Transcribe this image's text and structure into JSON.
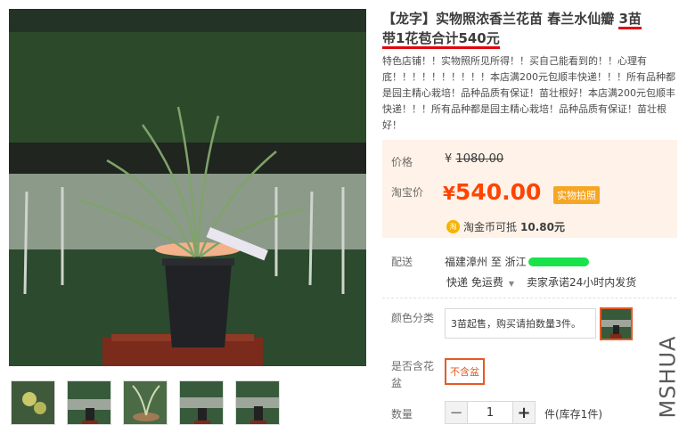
{
  "product": {
    "title_part1": "【龙字】实物照浓香兰花苗 春兰水仙瓣 ",
    "title_hl1": "3苗",
    "title_hl2": "带1花苞合计540元",
    "subtitle": "特色店铺！！实物照所见所得！！买自己能看到的！！心理有底！！！！！！！！！！本店满200元包顺丰快递！！！所有品种都是园主精心栽培！品种品质有保证！苗壮根好！本店满200元包顺丰快递！！！所有品种都是园主精心栽培！品种品质有保证！苗壮根好！"
  },
  "price": {
    "label": "价格",
    "original": "1080.00",
    "currency": "¥",
    "taobao_label": "淘宝价",
    "taobao_price": "540.00",
    "badge": "实物拍照",
    "coin_icon": "淘",
    "coin_text": "淘金币可抵",
    "coin_value": "10.80元"
  },
  "shipping": {
    "label": "配送",
    "from": "福建漳州 至  浙江",
    "method": "快递 免运费",
    "promise": "卖家承诺24小时内发货"
  },
  "color": {
    "label": "颜色分类",
    "option_text": "3苗起售，购买请拍数量3件。"
  },
  "pot": {
    "label": "是否含花盆",
    "option": "不含盆"
  },
  "quantity": {
    "label": "数量",
    "minus": "−",
    "value": "1",
    "plus": "+",
    "stock": "件(库存1件)"
  },
  "watermark": "MSHUA",
  "colors": {
    "price_red": "#ff4400",
    "accent_orange": "#e45a23",
    "price_bg": "#fff2e8",
    "underline_red": "#e4000f"
  }
}
